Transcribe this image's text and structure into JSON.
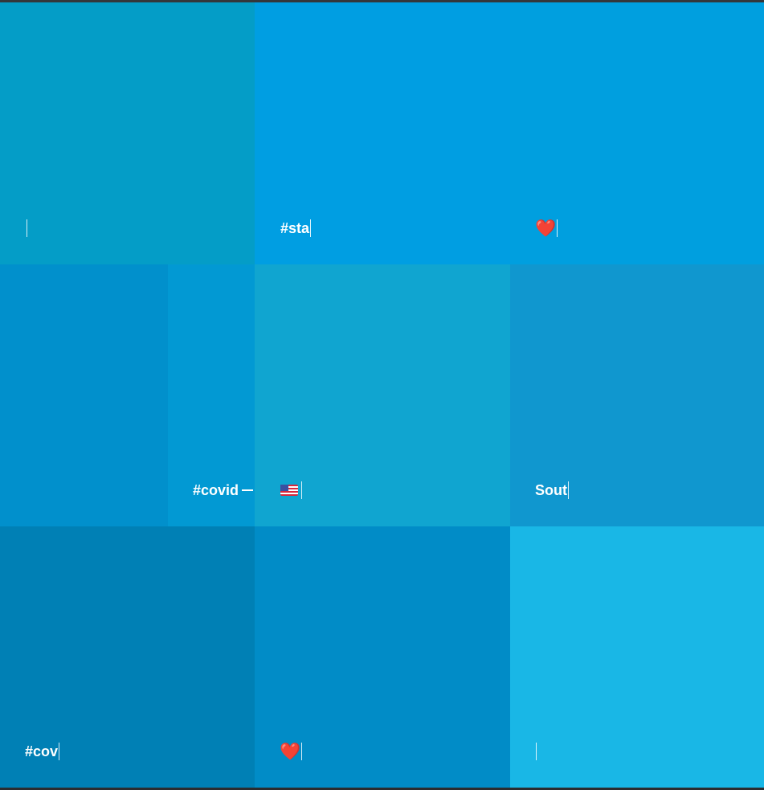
{
  "tiles": [
    {
      "id": "r1c1",
      "text": "",
      "color": "#049dc7"
    },
    {
      "id": "r1c2",
      "text": "#sta",
      "color": "#009ee2"
    },
    {
      "id": "r1c3",
      "text": "❤️",
      "icon": "red-heart-emoji",
      "color": "#009fdf"
    },
    {
      "id": "r2c1",
      "text": "#covid",
      "color": "#0190cc",
      "strip_color": "#0299d3"
    },
    {
      "id": "r2c2",
      "text": "",
      "icon": "us-flag-emoji",
      "color": "#10a5d0"
    },
    {
      "id": "r2c3",
      "text": "Sout",
      "color": "#1097cf"
    },
    {
      "id": "r3c1",
      "text": "#cov",
      "color": "#0080b5"
    },
    {
      "id": "r3c2",
      "text": "❤️",
      "icon": "red-heart-emoji",
      "color": "#018cc7"
    },
    {
      "id": "r3c3",
      "text": "",
      "color": "#19b7e6"
    }
  ],
  "colors": {
    "background": "#2b2d30",
    "text": "#ffffff",
    "heart": "#e8232f"
  }
}
